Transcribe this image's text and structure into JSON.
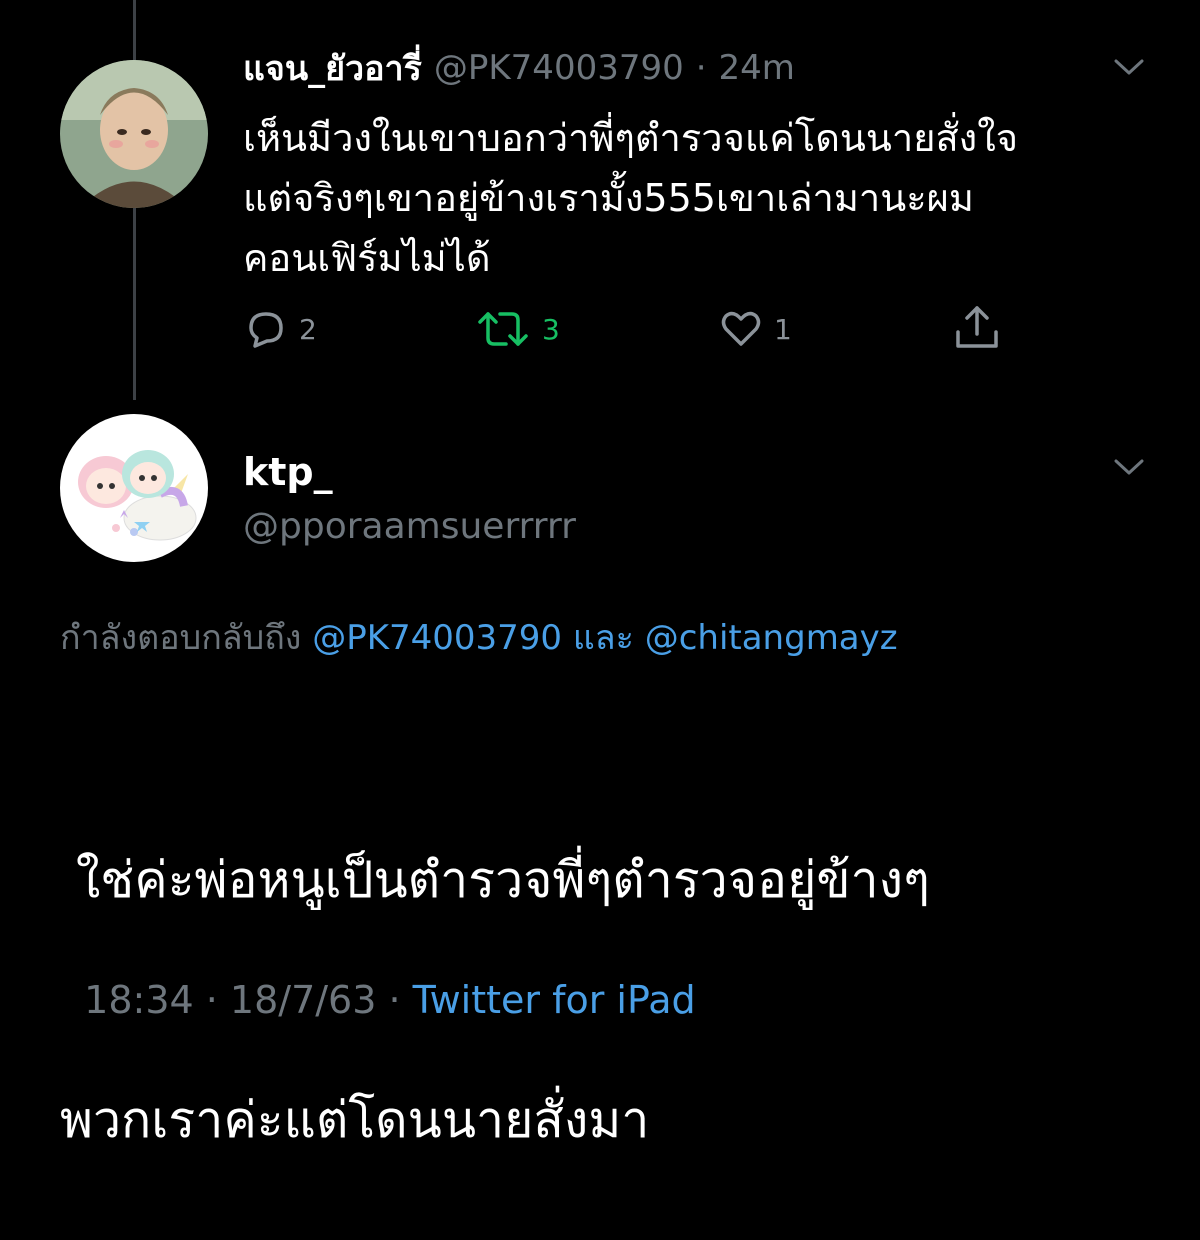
{
  "parent_tweet": {
    "display_name": "แจน_ยัวอารี่",
    "handle": "@PK74003790",
    "separator": "·",
    "time_ago": "24m",
    "text_lines": [
      "เห็นมีวงในเขาบอกว่าพี่ๆตำรวจแค่โดนนายสั่งใจ",
      "แต่จริงๆเขาอยู่ข้างเรามั้ง555เขาเล่ามานะผม",
      "คอนเฟิร์มไม่ได้"
    ],
    "actions": {
      "reply_count": "2",
      "retweet_count": "3",
      "like_count": "1",
      "reply_icon": "reply-icon",
      "retweet_icon": "retweet-icon",
      "like_icon": "heart-icon",
      "share_icon": "share-icon"
    }
  },
  "main_tweet": {
    "display_name": "ktp_",
    "handle": "@pporaamsuerrrrr",
    "replying_prefix": "กำลังตอบกลับถึง",
    "replying_user1": "@PK74003790",
    "replying_and": "และ",
    "replying_user2": "@chitangmayz",
    "text_lines": [
      " ใช่ค่ะพ่อหนูเป็นตำรวจพี่ๆตำรวจอยู่ข้างๆ",
      "พวกเราค่ะแต่โดนนายสั่งมา"
    ],
    "timestamp": "18:34 · 18/7/63 · ",
    "source": "Twitter for iPad"
  },
  "colors": {
    "background": "#000000",
    "text": "#ffffff",
    "muted": "#6e767d",
    "link": "#4a9fe6",
    "retweet_active": "#17bf63",
    "thread_line": "#3d4146"
  }
}
